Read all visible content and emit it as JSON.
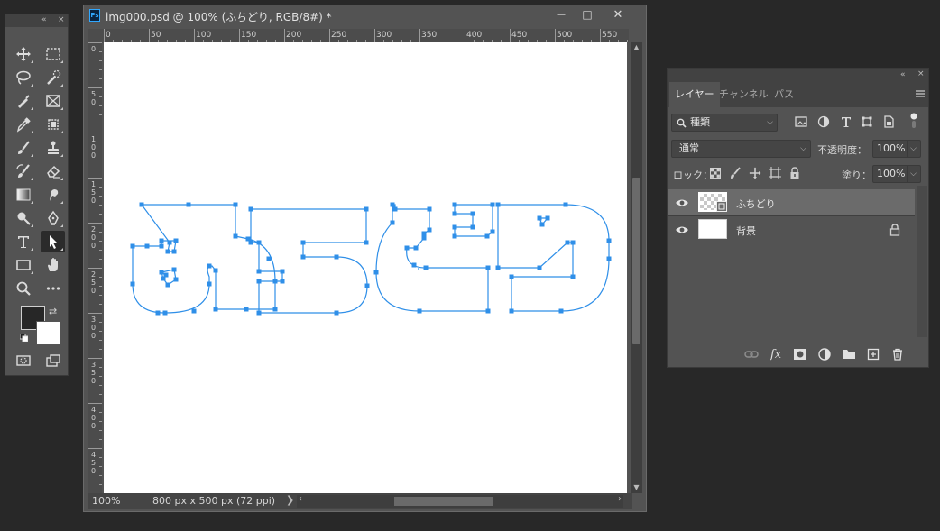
{
  "tools_panel": {
    "collapse_glyph": "«",
    "close_glyph": "×",
    "tools": [
      {
        "name": "move-tool",
        "icon": "move-icon"
      },
      {
        "name": "marquee-tool",
        "icon": "marquee-icon"
      },
      {
        "name": "lasso-tool",
        "icon": "lasso-icon"
      },
      {
        "name": "quick-selection-tool",
        "icon": "quick-selection-icon"
      },
      {
        "name": "eyedropper-tool",
        "icon": "eyedropper-icon"
      },
      {
        "name": "frame-tool",
        "icon": "frame-icon"
      },
      {
        "name": "crop-tool",
        "icon": "crop-icon"
      },
      {
        "name": "patch-tool",
        "icon": "patch-icon"
      },
      {
        "name": "brush-tool",
        "icon": "brush-icon"
      },
      {
        "name": "stamp-tool",
        "icon": "stamp-icon"
      },
      {
        "name": "history-brush-tool",
        "icon": "history-brush-icon"
      },
      {
        "name": "eraser-tool",
        "icon": "eraser-icon"
      },
      {
        "name": "gradient-tool",
        "icon": "gradient-icon"
      },
      {
        "name": "smudge-tool",
        "icon": "smudge-icon"
      },
      {
        "name": "dodge-tool",
        "icon": "dodge-icon"
      },
      {
        "name": "pen-tool",
        "icon": "pen-icon"
      },
      {
        "name": "type-tool",
        "icon": "type-icon"
      },
      {
        "name": "direct-selection-tool",
        "icon": "arrow-icon"
      },
      {
        "name": "rectangle-tool",
        "icon": "rectangle-icon"
      },
      {
        "name": "hand-tool",
        "icon": "hand-icon"
      },
      {
        "name": "zoom-tool",
        "icon": "zoom-icon"
      },
      {
        "name": "more-tools",
        "icon": "ellipsis-icon"
      },
      {
        "name": "quick-mask-button",
        "icon": "quick-mask-icon"
      },
      {
        "name": "screen-mode-button",
        "icon": "screen-mode-icon"
      }
    ],
    "foreground_color": "#272727",
    "background_color": "#ffffff"
  },
  "document": {
    "title": "img000.psd @ 100% (ふちどり, RGB/8#) *",
    "app_icon_label": "Ps",
    "minimize_glyph": "—",
    "maximize_glyph": "□",
    "close_glyph": "✕",
    "ruler_h_labels": [
      "0",
      "50",
      "100",
      "150",
      "200",
      "250",
      "300",
      "350",
      "400",
      "450",
      "500",
      "550"
    ],
    "ruler_v_labels": [
      "0",
      "50",
      "100",
      "150",
      "200",
      "250",
      "300",
      "350",
      "400",
      "450",
      "500"
    ],
    "zoom": "100%",
    "doc_info": "800 px x 500 px (72 ppi)",
    "status_arrow": "❯",
    "path_color": "#2f8fe8"
  },
  "layers_panel": {
    "collapse_glyph": "«",
    "close_glyph": "×",
    "tabs": [
      "レイヤー",
      "チャンネル",
      "パス"
    ],
    "active_tab": 0,
    "filter_kind": "種類",
    "blend_mode": "通常",
    "opacity_label": "不透明度：",
    "opacity_value": "100%",
    "lock_label": "ロック：",
    "fill_label": "塗り：",
    "fill_value": "100%",
    "layers": [
      {
        "name": "ふちどり",
        "selected": true,
        "locked": false
      },
      {
        "name": "背景",
        "selected": false,
        "locked": true
      }
    ],
    "footer_icons": [
      "link-icon",
      "fx-icon",
      "mask-icon",
      "adjustment-icon",
      "folder-icon",
      "new-layer-icon",
      "trash-icon"
    ],
    "fx_label": "fx"
  }
}
